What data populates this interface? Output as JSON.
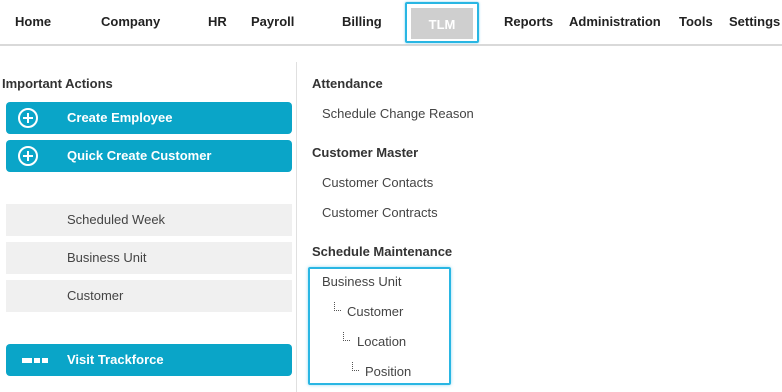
{
  "nav": {
    "items": [
      "Home",
      "Company",
      "HR",
      "Payroll",
      "Billing",
      "Reports",
      "Administration",
      "Tools",
      "Settings"
    ],
    "active": "TLM"
  },
  "left": {
    "title": "Important Actions",
    "actions": [
      "Create Employee",
      "Quick Create Customer"
    ],
    "quick_links": [
      "Scheduled Week",
      "Business Unit",
      "Customer"
    ],
    "visit_label": "Visit Trackforce"
  },
  "right": {
    "sections": [
      {
        "title": "Attendance",
        "items": [
          "Schedule Change Reason"
        ]
      },
      {
        "title": "Customer Master",
        "items": [
          "Customer Contacts",
          "Customer Contracts"
        ]
      },
      {
        "title": "Schedule Maintenance",
        "items": [
          "Business Unit",
          "Customer",
          "Location",
          "Position"
        ]
      }
    ]
  },
  "colors": {
    "accent": "#0aa5c8",
    "highlight": "#29b6e3",
    "tile": "#f0f0f0"
  }
}
